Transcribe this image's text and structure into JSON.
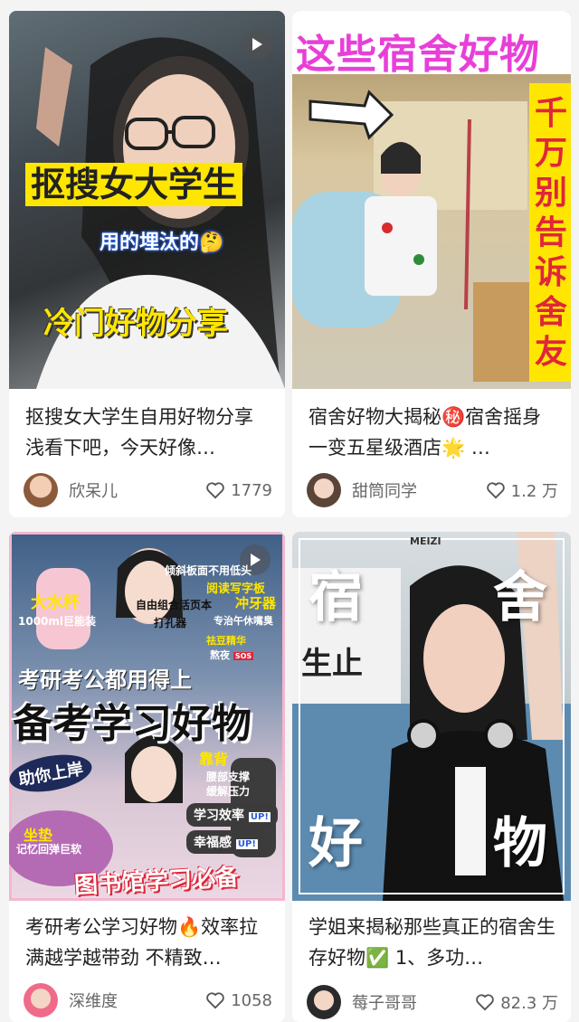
{
  "cards": [
    {
      "overlay": {
        "line1": "抠搜女大学生",
        "line2": "用的埋汰的🤔",
        "line3": "冷门好物分享"
      },
      "caption": "抠搜女大学生自用好物分享 浅看下吧，今天好像…",
      "user": "欣呆儿",
      "likes": "1779"
    },
    {
      "overlay": {
        "title": "这些宿舍好物",
        "side": "千万别告诉舍友"
      },
      "caption": "宿舍好物大揭秘㊙️宿舍摇身一变五星级酒店🌟 …",
      "user": "甜筒同学",
      "likes": "1.2 万"
    },
    {
      "overlay": {
        "t1": "倾斜板面不用低头",
        "t2": "阅读写字板",
        "t3": "大水杯",
        "t4": "1000ml巨能装",
        "t5": "自由组合活页本",
        "t6": "打孔器",
        "t7": "冲牙器",
        "t8": "专治午休嘴臭",
        "t9": "祛豆精华",
        "t10": "熬夜",
        "t11": "SOS",
        "headline1": "考研考公都用得上",
        "headline2": "备考学习好物",
        "t12": "靠背",
        "t13": "腰部支撑",
        "t14": "缓解压力",
        "t15": "助你上岸",
        "t16": "学习效率",
        "t17": "幸福感",
        "up": "UP!",
        "t18": "坐垫",
        "t19": "记忆回弹巨软",
        "banner": "图书馆学习必备"
      },
      "caption": "考研考公学习好物🔥效率拉满越学越带劲 不精致…",
      "user": "深维度",
      "likes": "1058"
    },
    {
      "overlay": {
        "c1": "宿",
        "c2": "舍",
        "c3": "好",
        "c4": "物",
        "mark": "MEIZI",
        "sign": "生止"
      },
      "caption": "学姐来揭秘那些真正的宿舍生存好物✅ 1、多功…",
      "user": "莓子哥哥",
      "likes": "82.3 万"
    }
  ],
  "colors": {
    "accent_red": "#e0263a",
    "title_yellow": "#ffe600",
    "magenta": "#e83fd8"
  }
}
